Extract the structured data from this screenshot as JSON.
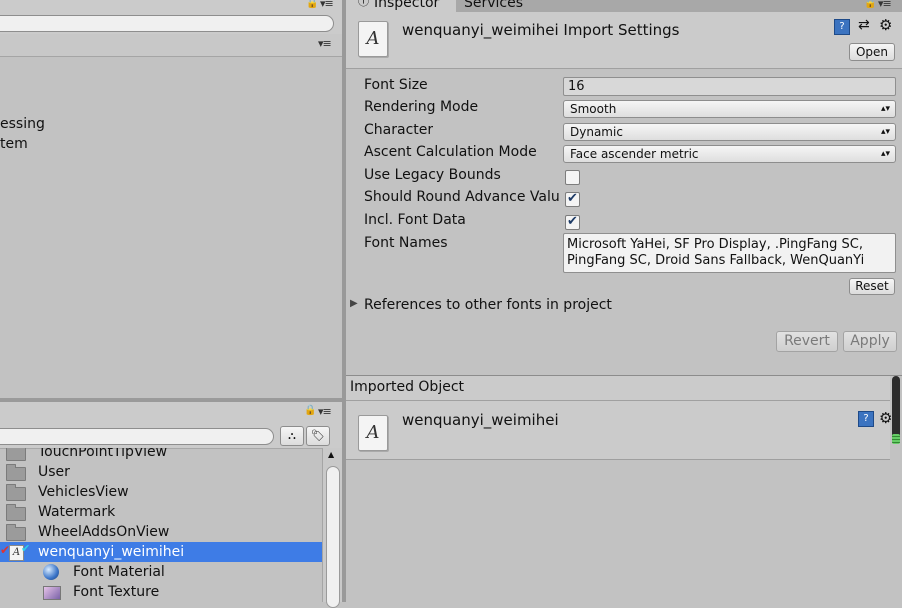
{
  "colors": {
    "panel_bg": "#c2c2c2",
    "selection": "#3e7ce6",
    "accent_dark": "#1c3a66"
  },
  "hierarchy": {
    "items": [
      {
        "label": "essing"
      },
      {
        "label": "tem"
      }
    ]
  },
  "tabs": [
    {
      "label": "Inspector",
      "icon": "info-icon"
    },
    {
      "label": "Services"
    }
  ],
  "inspector": {
    "title": "wenquanyi_weimihei Import Settings",
    "thumb_glyph": "A",
    "open_button": "Open",
    "fields": {
      "font_size": {
        "label": "Font Size",
        "value": "16"
      },
      "rendering_mode": {
        "label": "Rendering Mode",
        "value": "Smooth"
      },
      "character": {
        "label": "Character",
        "value": "Dynamic"
      },
      "ascent_mode": {
        "label": "Ascent Calculation Mode",
        "value": "Face ascender metric"
      },
      "legacy_bounds": {
        "label": "Use Legacy Bounds",
        "checked": false
      },
      "round_advance": {
        "label": "Should Round Advance Valu",
        "checked": true
      },
      "incl_font_data": {
        "label": "Incl. Font Data",
        "checked": true
      },
      "font_names": {
        "label": "Font Names",
        "line1": "Microsoft YaHei, SF Pro Display, .PingFang SC,",
        "line2": "PingFang SC, Droid Sans Fallback, WenQuanYi"
      }
    },
    "reset_button": "Reset",
    "references_label": "References to other fonts in project",
    "revert_button": "Revert",
    "apply_button": "Apply"
  },
  "imported": {
    "section_title": "Imported Object",
    "name": "wenquanyi_weimihei",
    "thumb_glyph": "A"
  },
  "project": {
    "items": [
      {
        "label": "TouchPointTipView",
        "icon": "folder-icon"
      },
      {
        "label": "User",
        "icon": "folder-icon"
      },
      {
        "label": "VehiclesView",
        "icon": "folder-icon"
      },
      {
        "label": "Watermark",
        "icon": "folder-icon"
      },
      {
        "label": "WheelAddsOnView",
        "icon": "folder-icon"
      },
      {
        "label": "wenquanyi_weimihei",
        "icon": "font-asset-icon",
        "selected": true
      },
      {
        "label": "Font Material",
        "icon": "material-sphere-icon"
      },
      {
        "label": "Font Texture",
        "icon": "texture-icon"
      }
    ]
  }
}
